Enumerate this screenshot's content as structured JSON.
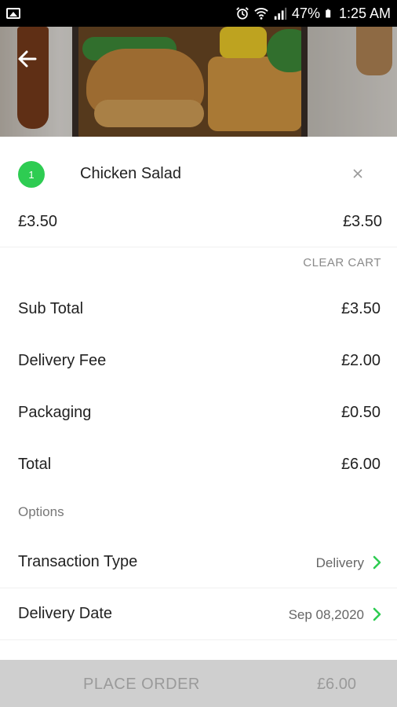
{
  "status_bar": {
    "battery": "47%",
    "time": "1:25 AM",
    "icons": [
      "image-icon",
      "alarm-icon",
      "wifi-icon",
      "signal-icon",
      "battery-icon"
    ]
  },
  "hero": {
    "back_icon": "arrow-left-icon"
  },
  "cart": {
    "items": [
      {
        "quantity": "1",
        "name": "Chicken Salad",
        "unit_price": "£3.50",
        "line_price": "£3.50",
        "remove_icon": "close-icon"
      }
    ],
    "clear_label": "CLEAR CART"
  },
  "summary": {
    "rows": [
      {
        "label": "Sub Total",
        "value": "£3.50"
      },
      {
        "label": "Delivery Fee",
        "value": "£2.00"
      },
      {
        "label": "Packaging",
        "value": "£0.50"
      },
      {
        "label": "Total",
        "value": "£6.00"
      }
    ]
  },
  "options": {
    "header": "Options",
    "rows": [
      {
        "label": "Transaction Type",
        "value": "Delivery",
        "icon": "chevron-right-icon"
      },
      {
        "label": "Delivery Date",
        "value": "Sep 08,2020",
        "icon": "chevron-right-icon"
      }
    ]
  },
  "footer": {
    "place_order_label": "PLACE ORDER",
    "total": "£6.00"
  },
  "colors": {
    "accent_green": "#2ecc52",
    "footer_bg": "#cfcfcf",
    "footer_text": "#9a9a9a"
  }
}
